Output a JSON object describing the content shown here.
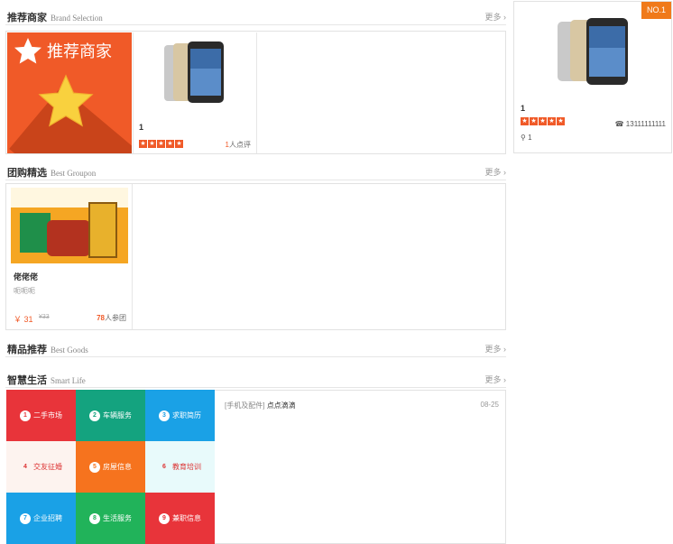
{
  "brand_section": {
    "title": "推荐商家",
    "subtitle": "Brand Selection",
    "more": "更多 ›"
  },
  "rec_banner": {
    "title": "推荐商家"
  },
  "rec_card": {
    "name": "1",
    "review_count": "1",
    "review_suffix": "人点评",
    "rating": 5
  },
  "no1_card": {
    "badge": "NO.1",
    "name": "1",
    "phone": "13111111111",
    "location": "1",
    "rating": 5
  },
  "groupon_section": {
    "title": "团购精选",
    "subtitle": "Best Groupon",
    "more": "更多 ›"
  },
  "groupon_card": {
    "name": "佬佬佬",
    "desc": "呃呃呃",
    "price": "￥ 31",
    "old_price": "¥33",
    "joined_count": "78",
    "joined_suffix": "人参团"
  },
  "goods_section": {
    "title": "精品推荐",
    "subtitle": "Best Goods",
    "more": "更多 ›"
  },
  "smart_section": {
    "title": "智慧生活",
    "subtitle": "Smart Life",
    "more": "更多 ›"
  },
  "smart_tiles": [
    {
      "num": "1",
      "label": "二手市场",
      "color": "#e8343a"
    },
    {
      "num": "2",
      "label": "车辆服务",
      "color": "#14a37f"
    },
    {
      "num": "3",
      "label": "求职简历",
      "color": "#1aa1e6"
    },
    {
      "num": "4",
      "label": "交友征婚",
      "color": "#fdf3ef"
    },
    {
      "num": "5",
      "label": "房屋信息",
      "color": "#f6731e"
    },
    {
      "num": "6",
      "label": "教育培训",
      "color": "#e8fafb"
    },
    {
      "num": "7",
      "label": "企业招聘",
      "color": "#1aa1e6"
    },
    {
      "num": "8",
      "label": "生活服务",
      "color": "#21b35a"
    },
    {
      "num": "9",
      "label": "兼职信息",
      "color": "#e8343a"
    }
  ],
  "news": [
    {
      "category": "[手机及配件]",
      "title": "点点滴滴",
      "date": "08-25"
    }
  ],
  "colors": {
    "accent": "#f05a28",
    "badge": "#f07a1a"
  }
}
